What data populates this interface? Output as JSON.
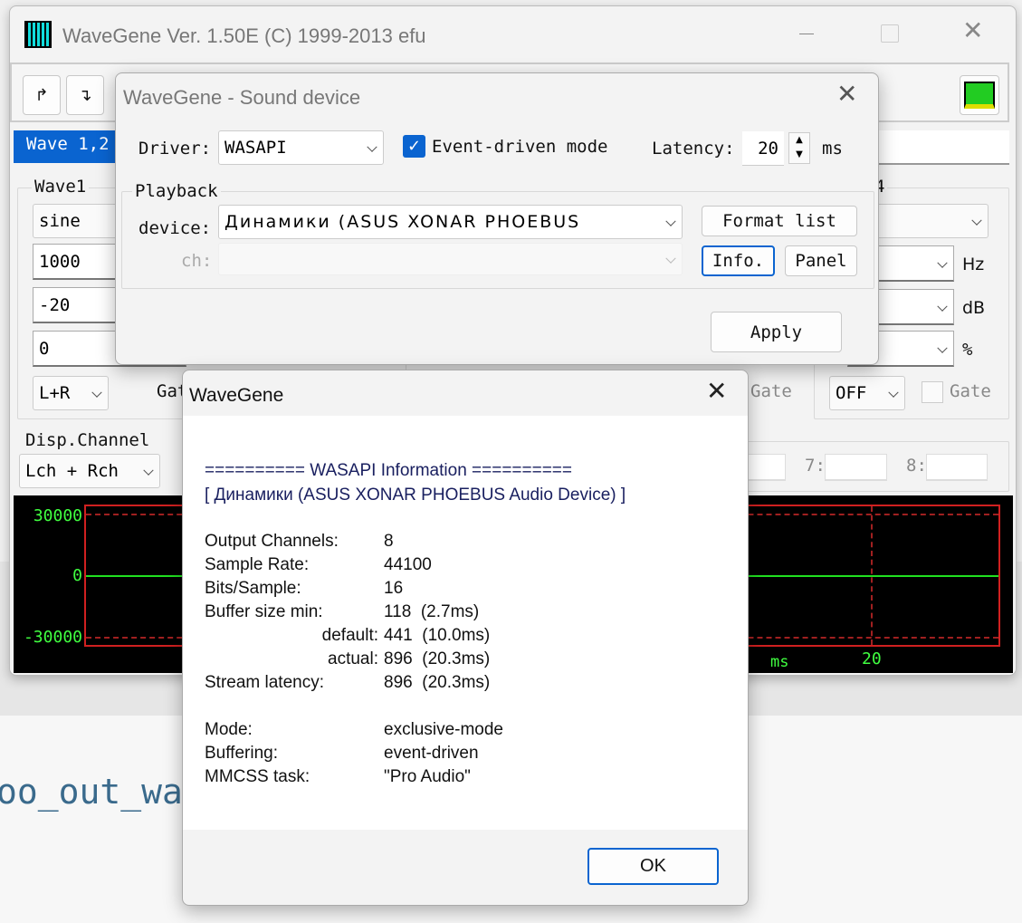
{
  "background": {
    "text": "oo_out_wa"
  },
  "main": {
    "title": "WaveGene  Ver. 1.50E  (C) 1999-2013 efu",
    "tab": "Wave 1,2",
    "wave1": {
      "label": "Wave1",
      "type": "sine",
      "freq": "1000",
      "level": "-20",
      "phase": "0",
      "channel": "L+R",
      "gate_label": "Gat"
    },
    "wave4": {
      "label": "4",
      "hz": "Hz",
      "db": "dB",
      "pct": "%",
      "gate_mode": "OFF",
      "gate_label": "Gate"
    },
    "gate3_label": "Gate",
    "disp": {
      "label": "Disp.Channel",
      "value": "Lch + Rch",
      "ch7": "7:",
      "ch8": "8:"
    },
    "scope": {
      "y_max": "30000",
      "y_zero": "0",
      "y_min": "-30000",
      "x_unit": "ms",
      "x_tick": "20"
    }
  },
  "sound_dialog": {
    "title": "WaveGene - Sound device",
    "driver_label": "Driver:",
    "driver": "WASAPI",
    "event_label": "Event-driven mode",
    "event_checked": true,
    "latency_label": "Latency:",
    "latency": "20",
    "latency_unit": "ms",
    "playback_label": "Playback",
    "device_label": "device:",
    "device": "Динамики (ASUS XONAR PHOEBUS",
    "ch_label": "ch:",
    "format_list": "Format list",
    "info": "Info.",
    "panel": "Panel",
    "apply": "Apply"
  },
  "info_dialog": {
    "title": "WaveGene",
    "header": "========== WASAPI Information ==========",
    "device": "[ Динамики (ASUS XONAR PHOEBUS Audio Device) ]",
    "rows": [
      {
        "k": "Output Channels:",
        "v": "8"
      },
      {
        "k": "Sample Rate:",
        "v": "44100"
      },
      {
        "k": "Bits/Sample:",
        "v": "16"
      },
      {
        "k": "Buffer size min:",
        "v": "118  (2.7ms)"
      },
      {
        "k": "default:",
        "v": "441  (10.0ms)"
      },
      {
        "k": "actual:",
        "v": "896  (20.3ms)"
      },
      {
        "k": "Stream latency:",
        "v": "896  (20.3ms)"
      }
    ],
    "rows2": [
      {
        "k": "Mode:",
        "v": "exclusive-mode"
      },
      {
        "k": "Buffering:",
        "v": "event-driven"
      },
      {
        "k": "MMCSS task:",
        "v": "\"Pro Audio\""
      }
    ],
    "ok": "OK"
  },
  "colors": {
    "accent": "#0a64d0",
    "scope_bg": "#000000",
    "scope_grid": "#d02020",
    "scope_trace": "#20e020"
  }
}
